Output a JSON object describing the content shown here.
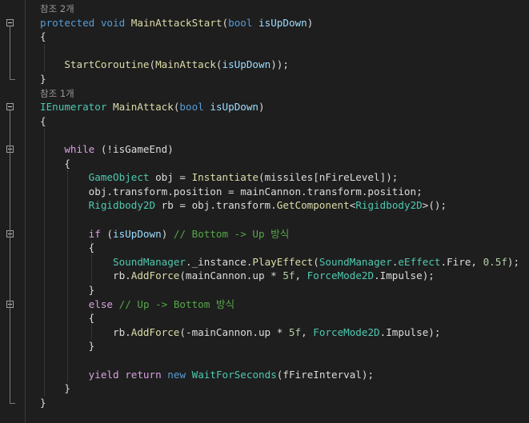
{
  "editor": {
    "lines": [
      {
        "ref": "참조 2개"
      },
      {
        "tokens": [
          [
            "kw",
            "protected"
          ],
          [
            "pl",
            " "
          ],
          [
            "kw",
            "void"
          ],
          [
            "pl",
            " "
          ],
          [
            "fn",
            "MainAttackStart"
          ],
          [
            "pl",
            "("
          ],
          [
            "kw",
            "bool"
          ],
          [
            "pl",
            " "
          ],
          [
            "pm",
            "isUpDown"
          ],
          [
            "pl",
            ")"
          ]
        ]
      },
      {
        "tokens": [
          [
            "pl",
            "{"
          ]
        ]
      },
      {
        "tokens": []
      },
      {
        "tokens": [
          [
            "pl",
            "    "
          ],
          [
            "fn",
            "StartCoroutine"
          ],
          [
            "pl",
            "("
          ],
          [
            "fn",
            "MainAttack"
          ],
          [
            "pl",
            "("
          ],
          [
            "pm",
            "isUpDown"
          ],
          [
            "pl",
            "));"
          ]
        ]
      },
      {
        "tokens": [
          [
            "pl",
            "}"
          ]
        ]
      },
      {
        "ref": "참조 1개"
      },
      {
        "tokens": [
          [
            "ty",
            "IEnumerator"
          ],
          [
            "pl",
            " "
          ],
          [
            "fn",
            "MainAttack"
          ],
          [
            "pl",
            "("
          ],
          [
            "kw",
            "bool"
          ],
          [
            "pl",
            " "
          ],
          [
            "pm",
            "isUpDown"
          ],
          [
            "pl",
            ")"
          ]
        ]
      },
      {
        "tokens": [
          [
            "pl",
            "{"
          ]
        ]
      },
      {
        "tokens": []
      },
      {
        "tokens": [
          [
            "pl",
            "    "
          ],
          [
            "ctl",
            "while"
          ],
          [
            "pl",
            " (!isGameEnd)"
          ]
        ]
      },
      {
        "tokens": [
          [
            "pl",
            "    {"
          ]
        ]
      },
      {
        "tokens": [
          [
            "pl",
            "        "
          ],
          [
            "ty",
            "GameObject"
          ],
          [
            "pl",
            " obj = "
          ],
          [
            "fn",
            "Instantiate"
          ],
          [
            "pl",
            "(missiles[nFireLevel]);"
          ]
        ]
      },
      {
        "tokens": [
          [
            "pl",
            "        obj.transform.position = mainCannon.transform.position;"
          ]
        ]
      },
      {
        "tokens": [
          [
            "pl",
            "        "
          ],
          [
            "ty",
            "Rigidbody2D"
          ],
          [
            "pl",
            " rb = obj.transform."
          ],
          [
            "fn",
            "GetComponent"
          ],
          [
            "pl",
            "<"
          ],
          [
            "ty",
            "Rigidbody2D"
          ],
          [
            "pl",
            ">();"
          ]
        ]
      },
      {
        "tokens": []
      },
      {
        "tokens": [
          [
            "pl",
            "        "
          ],
          [
            "ctl",
            "if"
          ],
          [
            "pl",
            " ("
          ],
          [
            "pm",
            "isUpDown"
          ],
          [
            "pl",
            ") "
          ],
          [
            "cm",
            "// Bottom -> Up 방식"
          ]
        ]
      },
      {
        "tokens": [
          [
            "pl",
            "        {"
          ]
        ]
      },
      {
        "tokens": [
          [
            "pl",
            "            "
          ],
          [
            "ty",
            "SoundManager"
          ],
          [
            "pl",
            "._instance."
          ],
          [
            "fn",
            "PlayEffect"
          ],
          [
            "pl",
            "("
          ],
          [
            "ty",
            "SoundManager"
          ],
          [
            "pl",
            "."
          ],
          [
            "ty",
            "eEffect"
          ],
          [
            "pl",
            ".Fire, "
          ],
          [
            "nm",
            "0.5f"
          ],
          [
            "pl",
            ");"
          ]
        ]
      },
      {
        "tokens": [
          [
            "pl",
            "            rb."
          ],
          [
            "fn",
            "AddForce"
          ],
          [
            "pl",
            "(mainCannon.up * "
          ],
          [
            "nm",
            "5f"
          ],
          [
            "pl",
            ", "
          ],
          [
            "ty",
            "ForceMode2D"
          ],
          [
            "pl",
            ".Impulse);"
          ]
        ]
      },
      {
        "tokens": [
          [
            "pl",
            "        }"
          ]
        ]
      },
      {
        "tokens": [
          [
            "pl",
            "        "
          ],
          [
            "ctl",
            "else"
          ],
          [
            "pl",
            " "
          ],
          [
            "cm",
            "// Up -> Bottom 방식"
          ]
        ]
      },
      {
        "tokens": [
          [
            "pl",
            "        {"
          ]
        ]
      },
      {
        "tokens": [
          [
            "pl",
            "            rb."
          ],
          [
            "fn",
            "AddForce"
          ],
          [
            "pl",
            "(-mainCannon.up * "
          ],
          [
            "nm",
            "5f"
          ],
          [
            "pl",
            ", "
          ],
          [
            "ty",
            "ForceMode2D"
          ],
          [
            "pl",
            ".Impulse);"
          ]
        ]
      },
      {
        "tokens": [
          [
            "pl",
            "        }"
          ]
        ]
      },
      {
        "tokens": []
      },
      {
        "tokens": [
          [
            "pl",
            "        "
          ],
          [
            "ctl",
            "yield"
          ],
          [
            "pl",
            " "
          ],
          [
            "ctl",
            "return"
          ],
          [
            "pl",
            " "
          ],
          [
            "kw",
            "new"
          ],
          [
            "pl",
            " "
          ],
          [
            "ty",
            "WaitForSeconds"
          ],
          [
            "pl",
            "(fFireInterval);"
          ]
        ]
      },
      {
        "tokens": [
          [
            "pl",
            "    }"
          ]
        ]
      },
      {
        "tokens": [
          [
            "pl",
            "}"
          ]
        ]
      }
    ],
    "colors": {
      "background": "#1e1e1e",
      "keyword": "#569cd6",
      "control": "#d8a0df",
      "type": "#4ec9b0",
      "method": "#dcdcaa",
      "parameter": "#9cdcfe",
      "comment": "#57a64a",
      "number": "#b5cea8",
      "plain": "#dcdcdc",
      "codelens": "#999999"
    }
  }
}
